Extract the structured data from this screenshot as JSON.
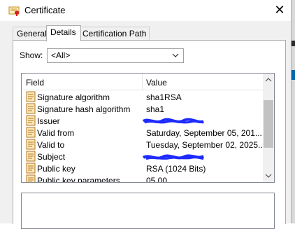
{
  "window": {
    "title": "Certificate",
    "close_label": "✕"
  },
  "tabs": [
    {
      "label": "General"
    },
    {
      "label": "Details"
    },
    {
      "label": "Certification Path"
    }
  ],
  "show": {
    "label": "Show:",
    "value": "<All>"
  },
  "list": {
    "columns": [
      "Field",
      "Value"
    ],
    "rows": [
      {
        "field": "Signature algorithm",
        "value": "sha1RSA"
      },
      {
        "field": "Signature hash algorithm",
        "value": "sha1"
      },
      {
        "field": "Issuer",
        "value": ""
      },
      {
        "field": "Valid from",
        "value": "Saturday, September 05, 201..."
      },
      {
        "field": "Valid to",
        "value": "Tuesday, September 02, 2025..."
      },
      {
        "field": "Subject",
        "value": ""
      },
      {
        "field": "Public key",
        "value": "RSA (1024 Bits)"
      },
      {
        "field": "Public key parameters",
        "value": "05 00"
      }
    ]
  },
  "icons": {
    "app": "certificate-icon",
    "row": "certificate-field-icon"
  },
  "colors": {
    "redaction": "#1e2bff",
    "scroll_thumb": "#c2c2c2"
  }
}
